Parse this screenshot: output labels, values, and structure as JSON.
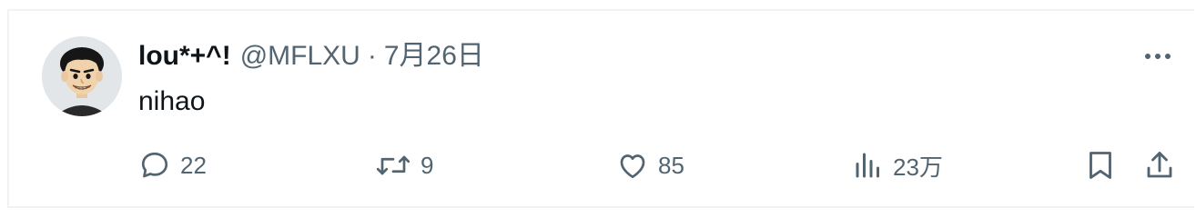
{
  "tweet": {
    "display_name": "lou*+^!",
    "handle": "@MFLXU",
    "separator": "·",
    "date": "7月26日",
    "text": "nihao"
  },
  "actions": {
    "reply_count": "22",
    "retweet_count": "9",
    "like_count": "85",
    "views_count": "23万"
  },
  "icons": {
    "reply": "speech-bubble-icon",
    "retweet": "retweet-arrows-icon",
    "like": "heart-icon",
    "views": "bar-chart-icon",
    "bookmark": "bookmark-icon",
    "share": "upload-share-icon",
    "more": "three-dots-icon"
  },
  "colors": {
    "text_primary": "#0f1419",
    "text_secondary": "#536471",
    "border": "#eff3f4"
  }
}
